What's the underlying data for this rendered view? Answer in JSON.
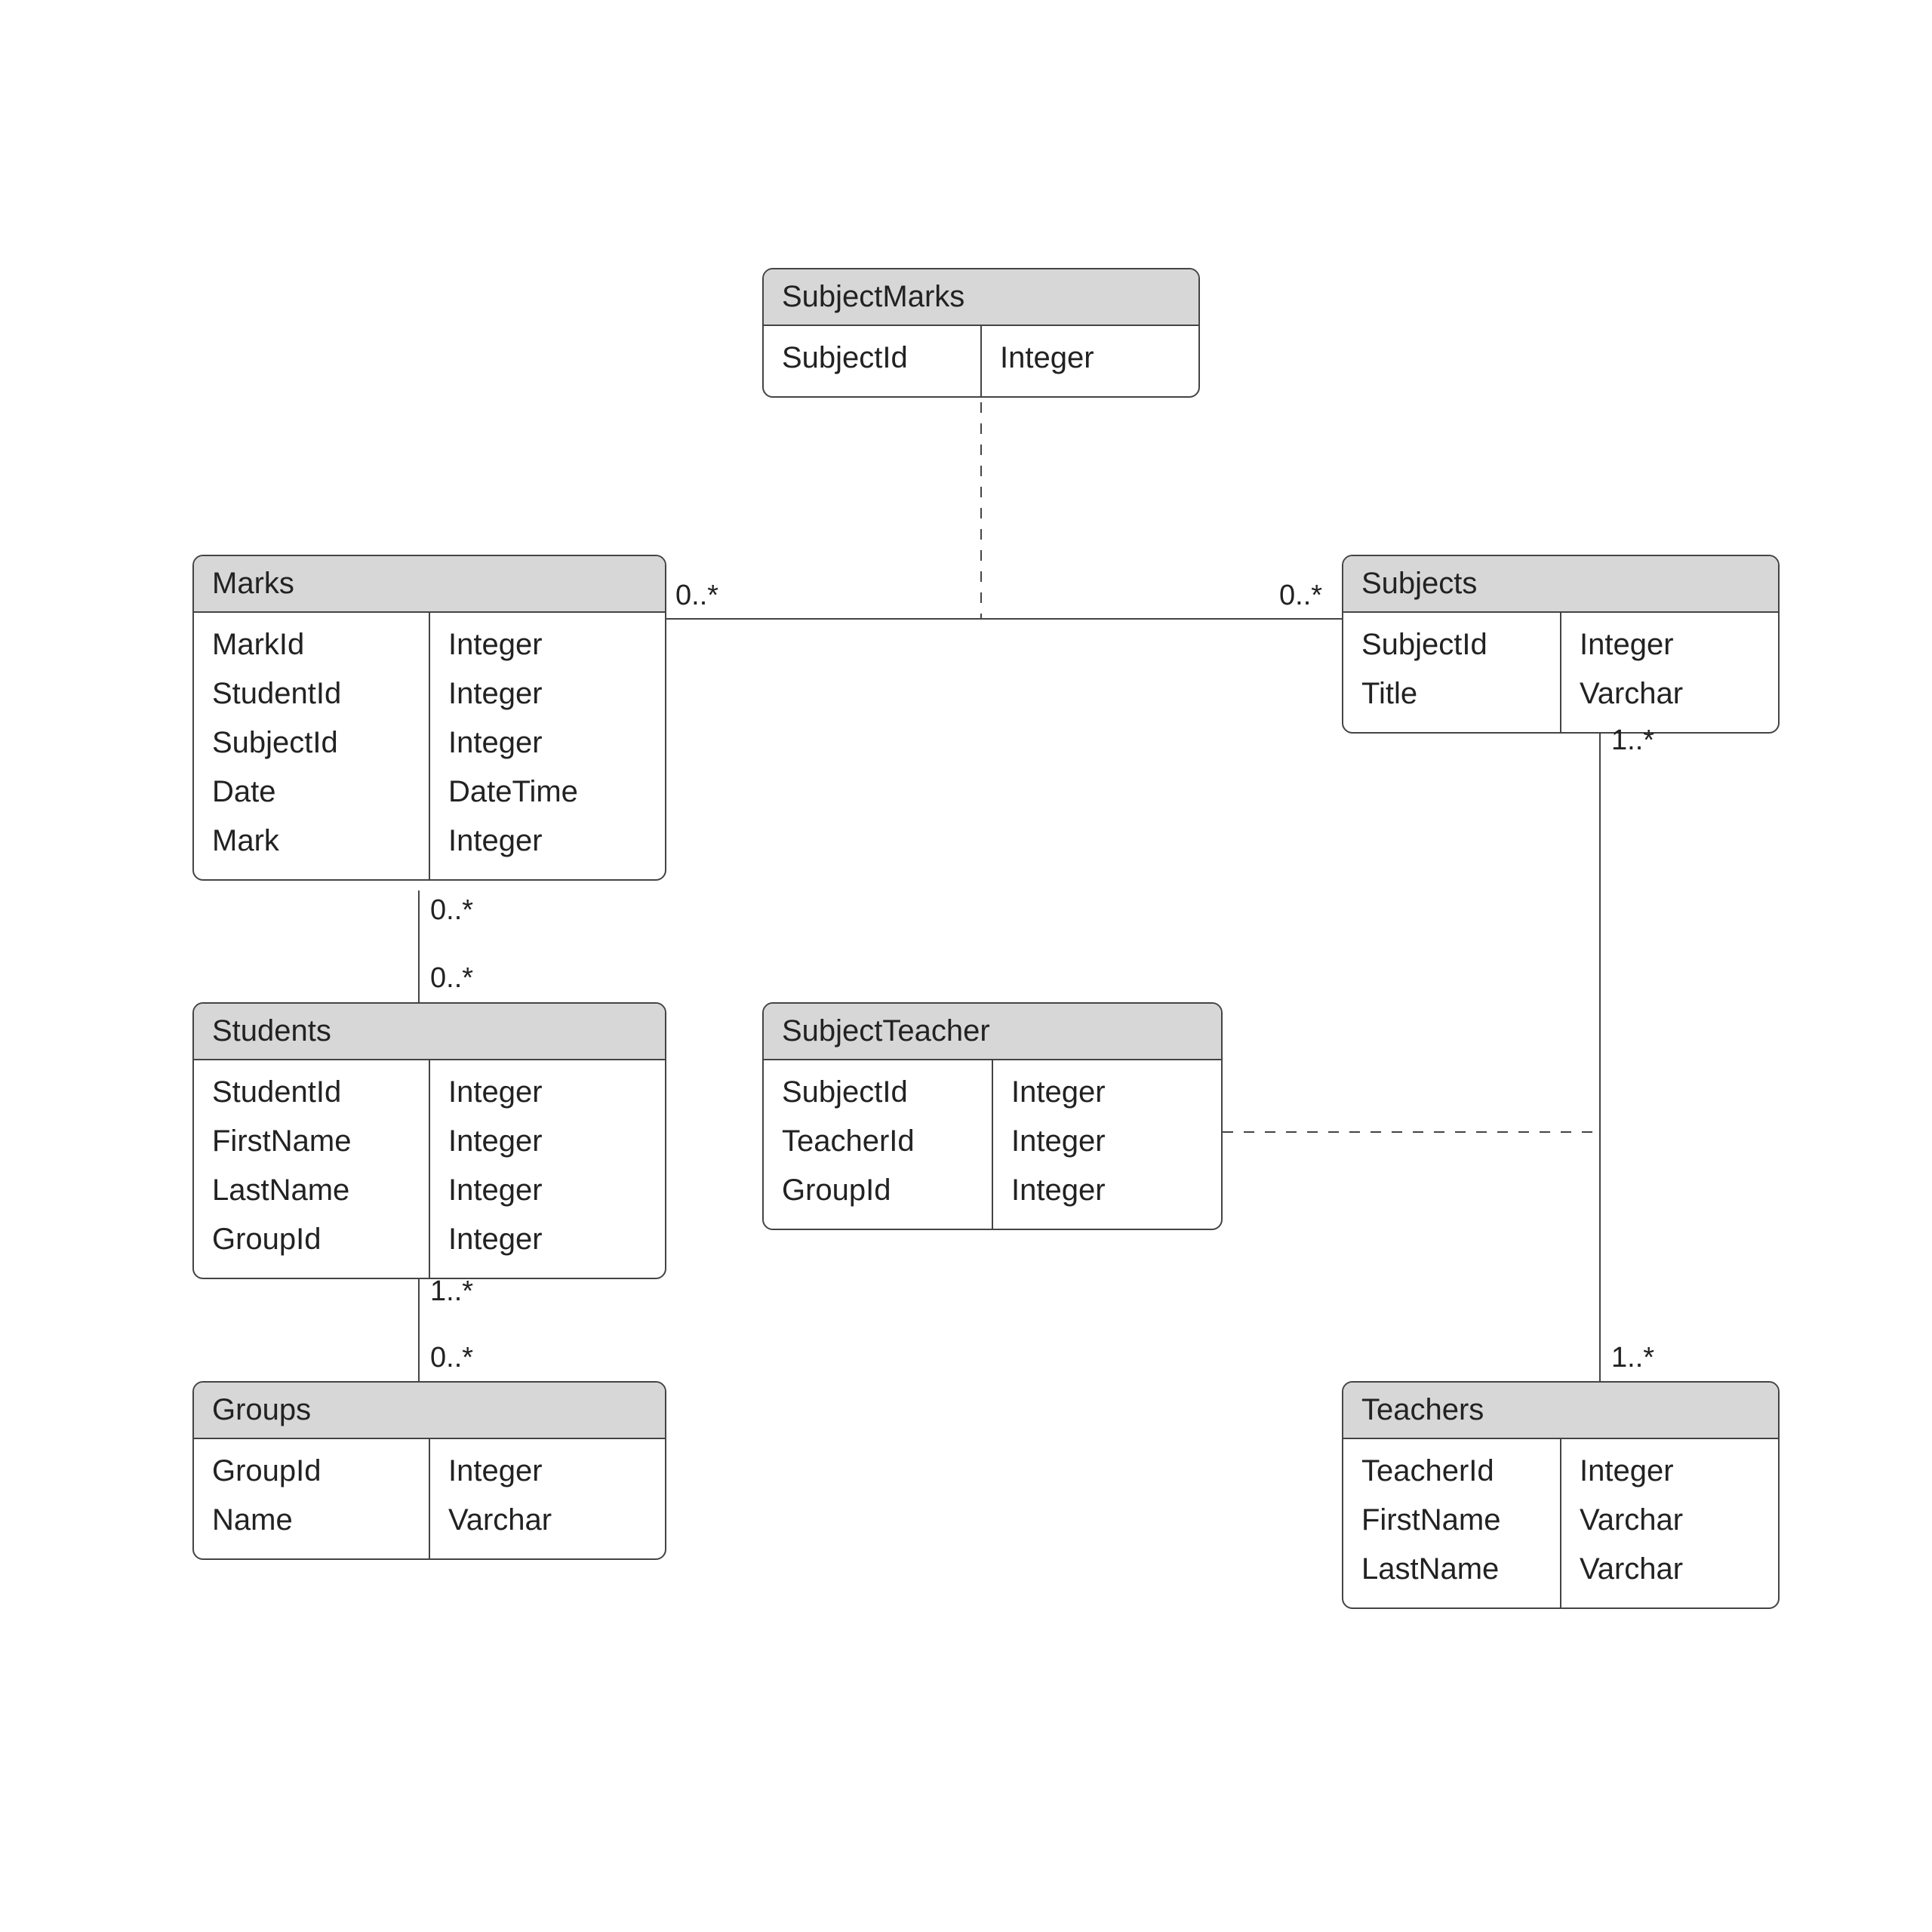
{
  "entities": {
    "subjectMarks": {
      "title": "SubjectMarks",
      "fields": [
        {
          "name": "SubjectId",
          "type": "Integer"
        }
      ]
    },
    "marks": {
      "title": "Marks",
      "fields": [
        {
          "name": "MarkId",
          "type": "Integer"
        },
        {
          "name": "StudentId",
          "type": "Integer"
        },
        {
          "name": "SubjectId",
          "type": "Integer"
        },
        {
          "name": "Date",
          "type": "DateTime"
        },
        {
          "name": "Mark",
          "type": "Integer"
        }
      ]
    },
    "subjects": {
      "title": "Subjects",
      "fields": [
        {
          "name": "SubjectId",
          "type": "Integer"
        },
        {
          "name": "Title",
          "type": "Varchar"
        }
      ]
    },
    "students": {
      "title": "Students",
      "fields": [
        {
          "name": "StudentId",
          "type": "Integer"
        },
        {
          "name": "FirstName",
          "type": "Integer"
        },
        {
          "name": "LastName",
          "type": "Integer"
        },
        {
          "name": "GroupId",
          "type": "Integer"
        }
      ]
    },
    "subjectTeacher": {
      "title": "SubjectTeacher",
      "fields": [
        {
          "name": "SubjectId",
          "type": "Integer"
        },
        {
          "name": "TeacherId",
          "type": "Integer"
        },
        {
          "name": "GroupId",
          "type": "Integer"
        }
      ]
    },
    "groups": {
      "title": "Groups",
      "fields": [
        {
          "name": "GroupId",
          "type": "Integer"
        },
        {
          "name": "Name",
          "type": "Varchar"
        }
      ]
    },
    "teachers": {
      "title": "Teachers",
      "fields": [
        {
          "name": "TeacherId",
          "type": "Integer"
        },
        {
          "name": "FirstName",
          "type": "Varchar"
        },
        {
          "name": "LastName",
          "type": "Varchar"
        }
      ]
    }
  },
  "multiplicities": {
    "marks_subjects_left": "0..*",
    "marks_subjects_right": "0..*",
    "marks_students_top": "0..*",
    "marks_students_bottom": "0..*",
    "students_groups_top": "1..*",
    "students_groups_bottom": "0..*",
    "subjects_teachers_top": "1..*",
    "subjects_teachers_bottom": "1..*"
  }
}
